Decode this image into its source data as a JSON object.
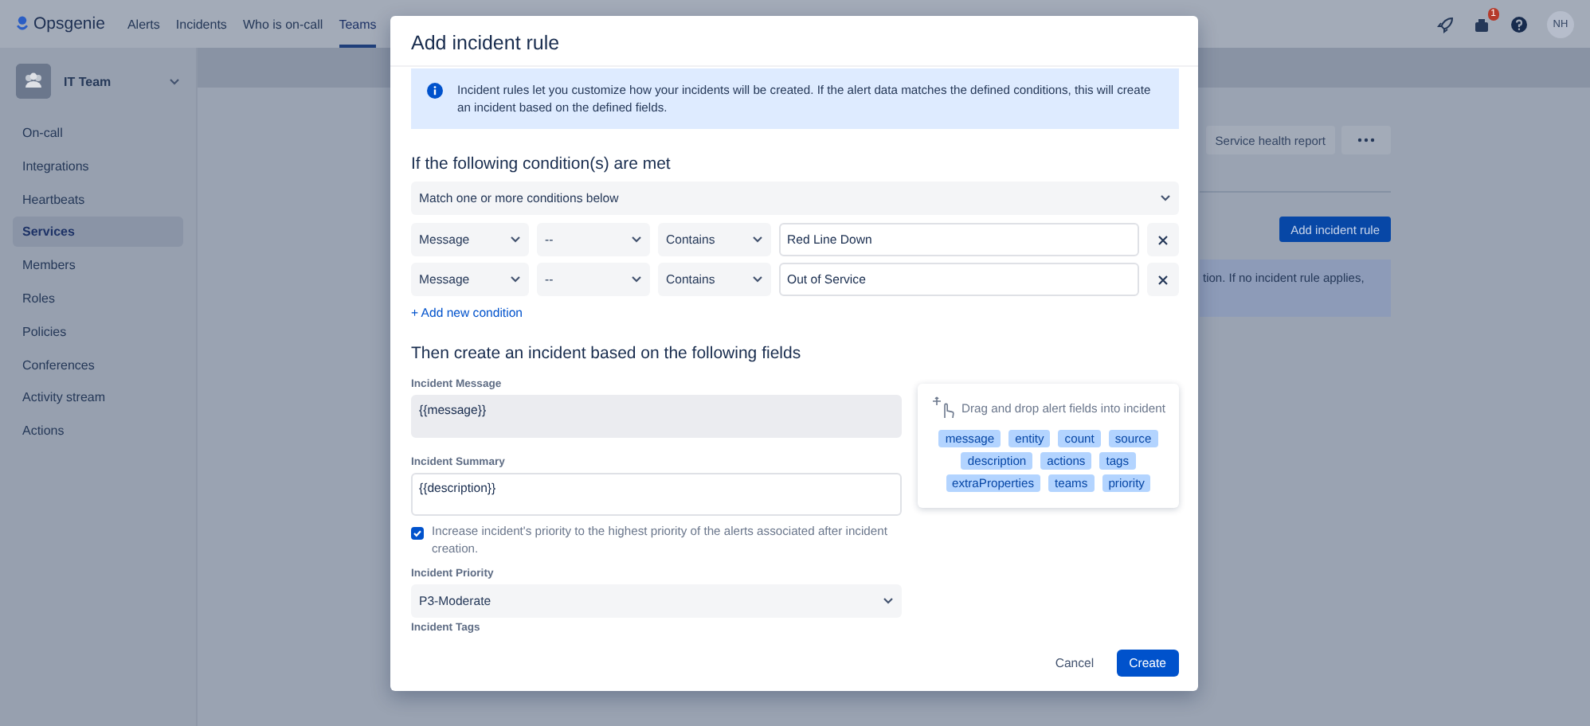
{
  "top_nav": {
    "logo": "Opsgenie",
    "items": [
      {
        "label": "Alerts",
        "selected": false
      },
      {
        "label": "Incidents",
        "selected": false
      },
      {
        "label": "Who is on-call",
        "selected": false
      },
      {
        "label": "Teams",
        "selected": true
      }
    ],
    "notification_badge": "1",
    "avatar": "NH"
  },
  "sidebar": {
    "team": "IT Team",
    "items": [
      {
        "label": "On-call",
        "selected": false
      },
      {
        "label": "Integrations",
        "selected": false
      },
      {
        "label": "Heartbeats",
        "selected": false
      },
      {
        "label": "Services",
        "selected": true
      },
      {
        "label": "Members",
        "selected": false
      },
      {
        "label": "Roles",
        "selected": false
      },
      {
        "label": "Policies",
        "selected": false
      },
      {
        "label": "Conferences",
        "selected": false
      },
      {
        "label": "Activity stream",
        "selected": false
      },
      {
        "label": "Actions",
        "selected": false
      }
    ]
  },
  "page": {
    "report_button": "Service health report",
    "add_button": "Add incident rule",
    "info_text": "tion. If no incident rule applies,"
  },
  "dialog": {
    "title": "Add incident rule",
    "info": "Incident rules let you customize how your incidents will be created. If the alert data matches the defined conditions, this will create an incident based on the defined fields.",
    "conditions_heading": "If the following condition(s) are met",
    "match_select": "Match one or more conditions below",
    "conditions": [
      {
        "field": "Message",
        "column_2": "--",
        "operator": "Contains",
        "value": "Red Line Down"
      },
      {
        "field": "Message",
        "column_2": "--",
        "operator": "Contains",
        "value": "Out of Service"
      }
    ],
    "add_condition": "+ Add new condition",
    "fields_heading": "Then create an incident based on the following fields",
    "message": {
      "label": "Incident Message",
      "value": "{{message}}",
      "disabled": true
    },
    "summary": {
      "label": "Incident Summary",
      "value": "{{description}}",
      "disabled": false
    },
    "increase_priority": {
      "label": "Increase incident's priority to the highest priority of the alerts associated after incident creation.",
      "checked": true
    },
    "priority": {
      "label": "Incident Priority",
      "value": "P3-Moderate"
    },
    "tags_label": "Incident Tags",
    "drag_panel": {
      "hint": "Drag and drop alert fields into incident",
      "chips": [
        "message",
        "entity",
        "count",
        "source",
        "description",
        "actions",
        "tags",
        "extraProperties",
        "teams",
        "priority"
      ]
    },
    "buttons": {
      "cancel": "Cancel",
      "create": "Create"
    }
  }
}
